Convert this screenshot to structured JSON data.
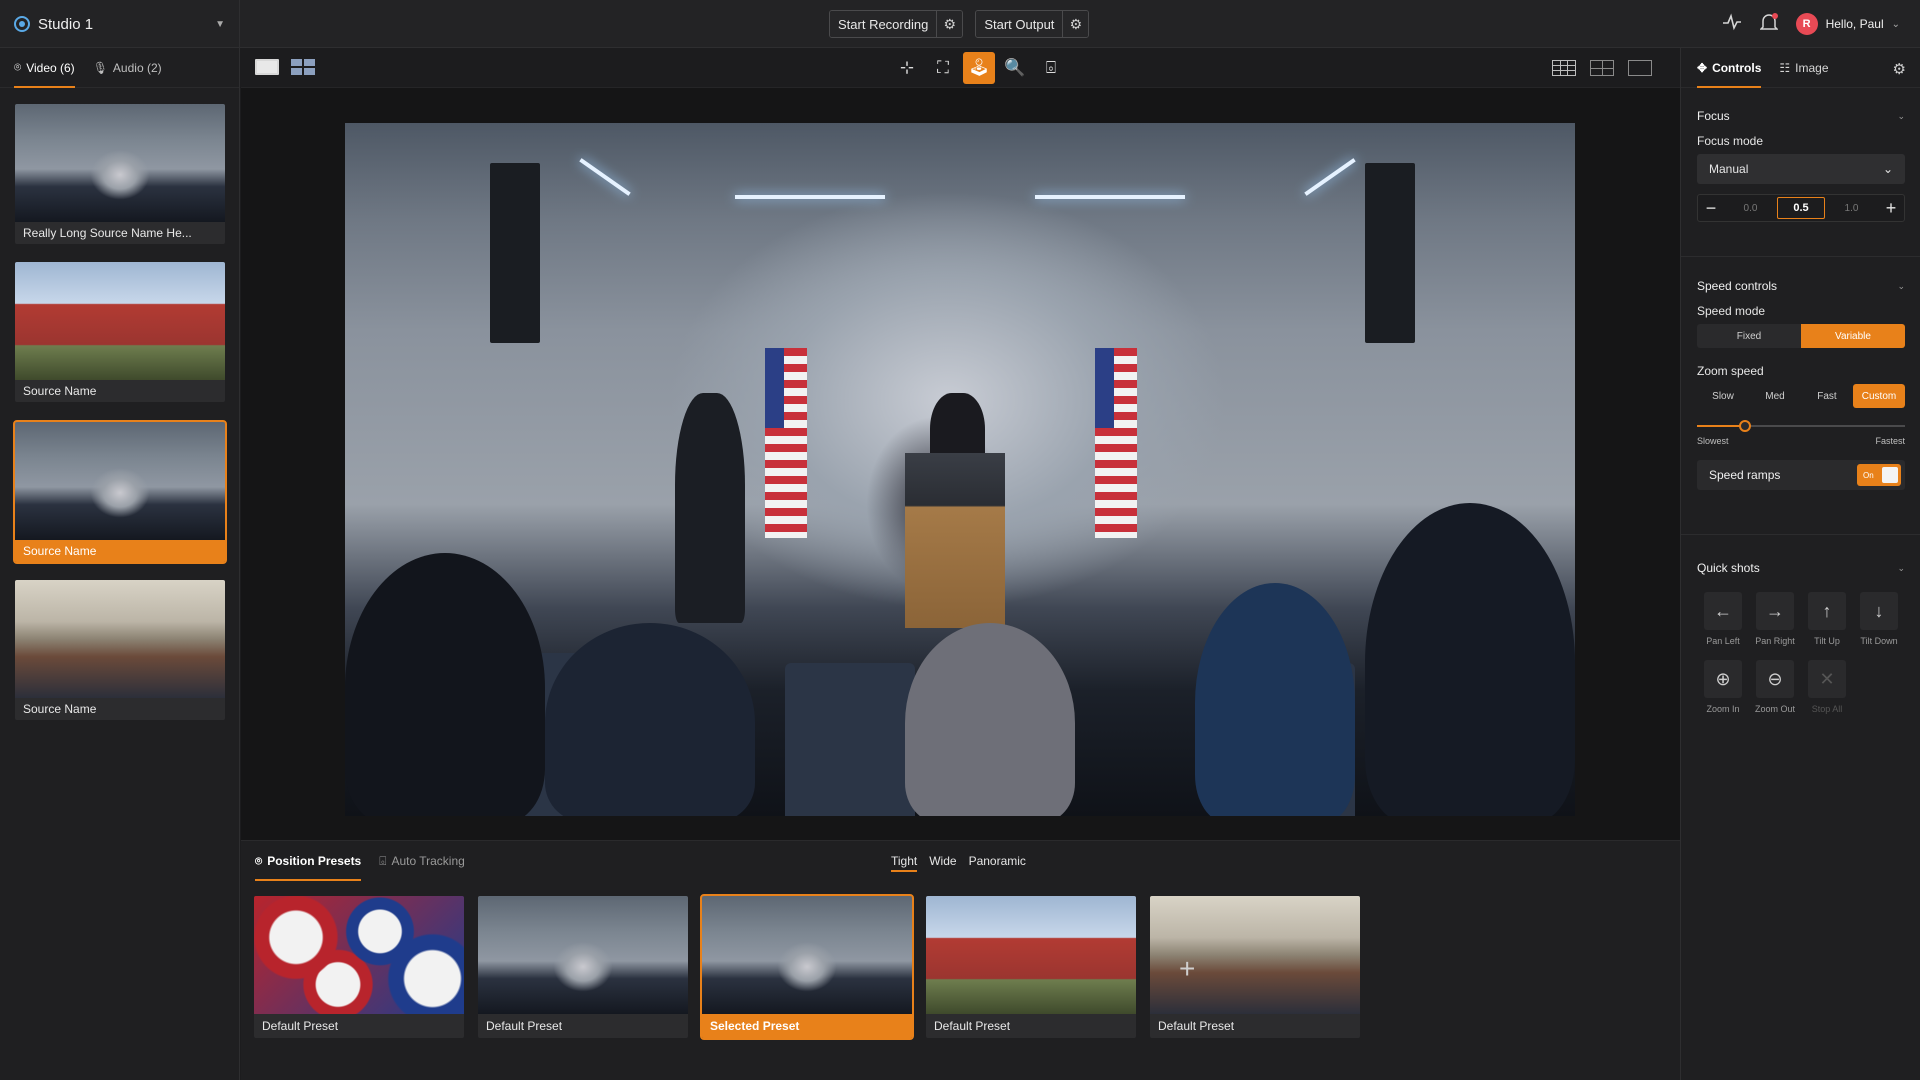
{
  "topbar": {
    "studio_name": "Studio 1",
    "start_recording": "Start Recording",
    "start_output": "Start Output",
    "avatar_initial": "R",
    "greeting": "Hello, Paul"
  },
  "sources": {
    "tabs": [
      {
        "label": "Video (6)",
        "active": true
      },
      {
        "label": "Audio (2)",
        "active": false
      }
    ],
    "items": [
      {
        "label": "Really Long Source Name He...",
        "thumb": "stage",
        "selected": false
      },
      {
        "label": "Source Name",
        "thumb": "hall",
        "selected": false
      },
      {
        "label": "Source Name",
        "thumb": "stage",
        "selected": true
      },
      {
        "label": "Source Name",
        "thumb": "room",
        "selected": false
      }
    ]
  },
  "presets": {
    "tabs": [
      {
        "label": "Position Presets",
        "active": true
      },
      {
        "label": "Auto Tracking",
        "active": false
      }
    ],
    "shot_types": [
      {
        "label": "Tight",
        "active": true
      },
      {
        "label": "Wide",
        "active": false
      },
      {
        "label": "Panoramic",
        "active": false
      }
    ],
    "items": [
      {
        "label": "Default Preset",
        "thumb": "buttons",
        "selected": false
      },
      {
        "label": "Default Preset",
        "thumb": "stage",
        "selected": false
      },
      {
        "label": "Selected Preset",
        "thumb": "stage",
        "selected": true
      },
      {
        "label": "Default Preset",
        "thumb": "hall",
        "selected": false
      },
      {
        "label": "Default Preset",
        "thumb": "room",
        "selected": false
      }
    ],
    "add_label": "+"
  },
  "right": {
    "tabs": [
      {
        "label": "Controls",
        "active": true
      },
      {
        "label": "Image",
        "active": false
      }
    ],
    "focus": {
      "title": "Focus",
      "mode_label": "Focus mode",
      "mode_value": "Manual",
      "min": "0.0",
      "current": "0.5",
      "max": "1.0"
    },
    "speed": {
      "title": "Speed controls",
      "mode_label": "Speed mode",
      "modes": [
        {
          "label": "Fixed",
          "on": false
        },
        {
          "label": "Variable",
          "on": true
        }
      ],
      "zoom_label": "Zoom speed",
      "zoom_options": [
        {
          "label": "Slow",
          "on": false
        },
        {
          "label": "Med",
          "on": false
        },
        {
          "label": "Fast",
          "on": false
        },
        {
          "label": "Custom",
          "on": true
        }
      ],
      "slider_value": 0.23,
      "slider_min_label": "Slowest",
      "slider_max_label": "Fastest",
      "ramps_label": "Speed ramps",
      "ramps_state": "On"
    },
    "quick": {
      "title": "Quick shots",
      "items": [
        {
          "label": "Pan Left",
          "icon": "arrow-left-icon",
          "glyph": "←",
          "disabled": false
        },
        {
          "label": "Pan Right",
          "icon": "arrow-right-icon",
          "glyph": "→",
          "disabled": false
        },
        {
          "label": "Tilt Up",
          "icon": "arrow-up-icon",
          "glyph": "↑",
          "disabled": false
        },
        {
          "label": "Tilt Down",
          "icon": "arrow-down-icon",
          "glyph": "↓",
          "disabled": false
        },
        {
          "label": "Zoom In",
          "icon": "zoom-in-icon",
          "glyph": "⊕",
          "disabled": false
        },
        {
          "label": "Zoom Out",
          "icon": "zoom-out-icon",
          "glyph": "⊖",
          "disabled": false
        },
        {
          "label": "Stop All",
          "icon": "close-icon",
          "glyph": "✕",
          "disabled": true
        }
      ]
    }
  },
  "colors": {
    "accent": "#e8811a",
    "background": "#1c1c1e",
    "avatar": "#e84a55"
  }
}
